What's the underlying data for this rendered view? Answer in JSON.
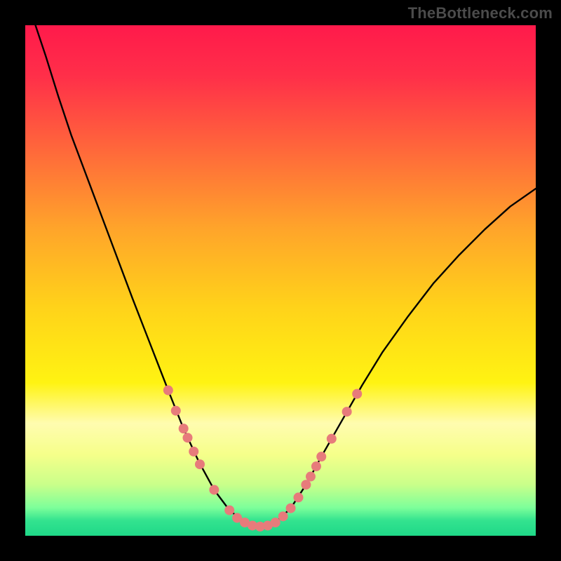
{
  "watermark": "TheBottleneck.com",
  "chart_data": {
    "type": "line",
    "title": "",
    "xlabel": "",
    "ylabel": "",
    "xlim": [
      0,
      100
    ],
    "ylim": [
      0,
      100
    ],
    "grid": false,
    "legend": false,
    "gradient_stops": [
      {
        "offset": 0.0,
        "color": "#ff1a4b"
      },
      {
        "offset": 0.1,
        "color": "#ff2f49"
      },
      {
        "offset": 0.25,
        "color": "#ff6a3a"
      },
      {
        "offset": 0.4,
        "color": "#ffa52a"
      },
      {
        "offset": 0.55,
        "color": "#ffd21a"
      },
      {
        "offset": 0.7,
        "color": "#fff312"
      },
      {
        "offset": 0.78,
        "color": "#fffcb0"
      },
      {
        "offset": 0.84,
        "color": "#f6ff8a"
      },
      {
        "offset": 0.9,
        "color": "#c9ff8a"
      },
      {
        "offset": 0.945,
        "color": "#7dff9a"
      },
      {
        "offset": 0.97,
        "color": "#33e38f"
      },
      {
        "offset": 1.0,
        "color": "#1fd888"
      }
    ],
    "series": [
      {
        "name": "curve",
        "stroke": "#000000",
        "stroke_width": 2.4,
        "points": [
          {
            "x": 2.0,
            "y": 100.0
          },
          {
            "x": 4.0,
            "y": 94.0
          },
          {
            "x": 6.5,
            "y": 86.0
          },
          {
            "x": 9.0,
            "y": 78.5
          },
          {
            "x": 12.0,
            "y": 70.5
          },
          {
            "x": 15.0,
            "y": 62.5
          },
          {
            "x": 18.0,
            "y": 54.5
          },
          {
            "x": 21.0,
            "y": 46.5
          },
          {
            "x": 24.5,
            "y": 37.5
          },
          {
            "x": 28.0,
            "y": 28.5
          },
          {
            "x": 31.0,
            "y": 21.0
          },
          {
            "x": 34.0,
            "y": 14.5
          },
          {
            "x": 37.0,
            "y": 9.0
          },
          {
            "x": 40.0,
            "y": 5.0
          },
          {
            "x": 43.0,
            "y": 2.6
          },
          {
            "x": 46.0,
            "y": 1.8
          },
          {
            "x": 49.0,
            "y": 2.6
          },
          {
            "x": 52.0,
            "y": 5.4
          },
          {
            "x": 55.0,
            "y": 10.0
          },
          {
            "x": 58.0,
            "y": 15.5
          },
          {
            "x": 62.0,
            "y": 22.5
          },
          {
            "x": 66.0,
            "y": 29.5
          },
          {
            "x": 70.0,
            "y": 36.0
          },
          {
            "x": 75.0,
            "y": 43.0
          },
          {
            "x": 80.0,
            "y": 49.5
          },
          {
            "x": 85.0,
            "y": 55.0
          },
          {
            "x": 90.0,
            "y": 60.0
          },
          {
            "x": 95.0,
            "y": 64.5
          },
          {
            "x": 100.0,
            "y": 68.0
          }
        ]
      },
      {
        "name": "markers",
        "type": "scatter",
        "fill": "#e77b7b",
        "stroke": "#e77b7b",
        "radius": 7,
        "points": [
          {
            "x": 28.0,
            "y": 28.5
          },
          {
            "x": 29.5,
            "y": 24.5
          },
          {
            "x": 31.0,
            "y": 21.0
          },
          {
            "x": 31.8,
            "y": 19.2
          },
          {
            "x": 33.0,
            "y": 16.5
          },
          {
            "x": 34.2,
            "y": 14.0
          },
          {
            "x": 37.0,
            "y": 9.0
          },
          {
            "x": 40.0,
            "y": 5.0
          },
          {
            "x": 41.5,
            "y": 3.5
          },
          {
            "x": 43.0,
            "y": 2.6
          },
          {
            "x": 44.5,
            "y": 2.0
          },
          {
            "x": 46.0,
            "y": 1.8
          },
          {
            "x": 47.5,
            "y": 2.0
          },
          {
            "x": 49.0,
            "y": 2.6
          },
          {
            "x": 50.5,
            "y": 3.8
          },
          {
            "x": 52.0,
            "y": 5.4
          },
          {
            "x": 53.5,
            "y": 7.5
          },
          {
            "x": 55.0,
            "y": 10.0
          },
          {
            "x": 55.9,
            "y": 11.6
          },
          {
            "x": 57.0,
            "y": 13.6
          },
          {
            "x": 58.0,
            "y": 15.5
          },
          {
            "x": 60.0,
            "y": 19.0
          },
          {
            "x": 63.0,
            "y": 24.3
          },
          {
            "x": 65.0,
            "y": 27.8
          }
        ]
      }
    ]
  }
}
